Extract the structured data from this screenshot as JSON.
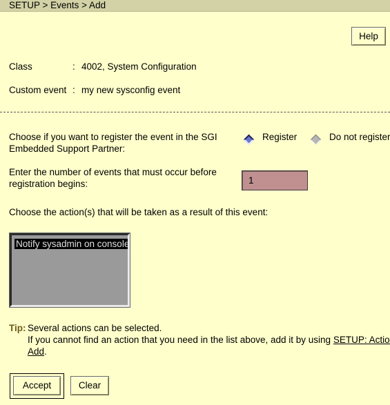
{
  "header": {
    "breadcrumb": "SETUP > Events > Add"
  },
  "toolbar": {
    "help_label": "Help"
  },
  "details": {
    "class_label": "Class",
    "class_sep": ":",
    "class_value": "4002, System Configuration",
    "custom_event_label": "Custom event",
    "custom_event_sep": ":",
    "custom_event_value": "my new sysconfig event"
  },
  "register": {
    "question_line1": "Choose if you want to register the event in the SGI",
    "question_line2": "Embedded Support Partner:",
    "option_register": "Register",
    "option_do_not_register": "Do not register",
    "selected": "Register"
  },
  "count": {
    "question_line1": "Enter the number of events that must occur before",
    "question_line2": "registration begins:",
    "value": "1"
  },
  "actions": {
    "prompt": "Choose the action(s) that will be taken as a result of this event:",
    "items": [
      "Notify sysadmin on console"
    ],
    "selected": "Notify sysadmin on console"
  },
  "tip": {
    "label": "Tip:",
    "line1": "Several actions can be selected.",
    "line2_prefix": "If you cannot find an action that you need in the list above, add it by using ",
    "link_part1": "SETUP: Actions:",
    "link_part2": "Add",
    "line3_suffix": "."
  },
  "footer": {
    "accept_label": "Accept",
    "clear_label": "Clear"
  },
  "colors": {
    "background": "#ffffcc",
    "titlebar": "#d2d2a6",
    "input": "#c09090",
    "listbox": "#9a9a9a",
    "tip_label": "#6f5a1b",
    "radio_selected": "#6b78c9"
  }
}
